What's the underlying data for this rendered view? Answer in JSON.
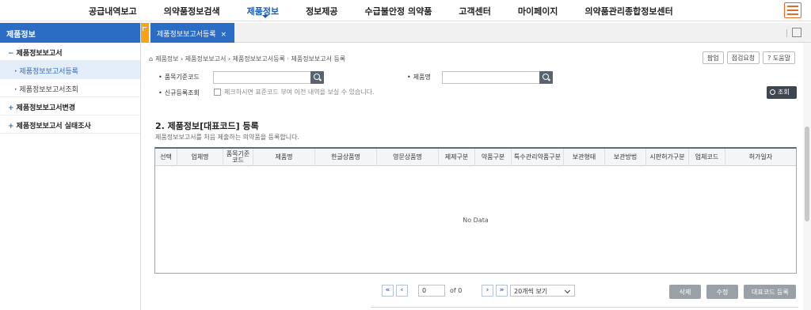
{
  "nav": {
    "items": [
      "공급내역보고",
      "의약품정보검색",
      "제품정보",
      "정보제공",
      "수급불안정 의약품",
      "고객센터",
      "마이페이지",
      "의약품관리종합정보센터"
    ],
    "active": "제품정보",
    "menu_icon": "hamburger-menu-icon"
  },
  "sidebar": {
    "title": "제품정보",
    "items": [
      {
        "label": "제품정보보고서",
        "mark": "−",
        "type": "group"
      },
      {
        "label": "제품정보보고서등록",
        "mark": "·",
        "type": "sub",
        "active": true
      },
      {
        "label": "제품정보보고서조회",
        "mark": "·",
        "type": "sub"
      },
      {
        "label": "제품정보보고서변경",
        "mark": "+",
        "type": "group"
      },
      {
        "label": "제품정보보고서 실태조사",
        "mark": "+",
        "type": "group"
      }
    ]
  },
  "tab": {
    "label": "제품정보보고서등록",
    "close": "×"
  },
  "breadcrumb": {
    "home_icon": "⌂",
    "text": "제품정보 › 제품정보보고서 › 제품정보보고서등록 · 제품정보보고서 등록"
  },
  "top_buttons": {
    "popup": "팝업",
    "inspect": "점검요청",
    "help": "? 도움말"
  },
  "search": {
    "code_label": "품목기준코드",
    "code_value": "",
    "name_label": "제품명",
    "name_value": "",
    "new_label": "신규등록조회",
    "new_note": "체크하시면 표준코드 부여 이전 내역을 보실 수 있습니다.",
    "query_button": "조회"
  },
  "section": {
    "title": "2. 제품정보[대표코드] 등록",
    "desc": "제품정보보고서를 처음 제출하는 의약품을 등록합니다."
  },
  "grid": {
    "columns": [
      "선택",
      "업체명",
      "품목기준코드",
      "제품명",
      "한글상품명",
      "영문상품명",
      "제제구분",
      "약품구분",
      "특수관리약품구분",
      "보관형태",
      "보관방법",
      "시판허가구분",
      "업체코드",
      "허가일자"
    ],
    "empty_text": "No Data"
  },
  "pager": {
    "first": "«",
    "prev": "‹",
    "page_value": "0",
    "of_text": "of 0",
    "next": "›",
    "last": "»",
    "per_page": "20개씩 보기"
  },
  "actions": {
    "delete": "삭제",
    "edit": "수정",
    "register": "대표코드 등록"
  },
  "colors": {
    "primary": "#2b6cc4",
    "accent": "#f7a21b",
    "menu_icon": "#e06a2a"
  }
}
